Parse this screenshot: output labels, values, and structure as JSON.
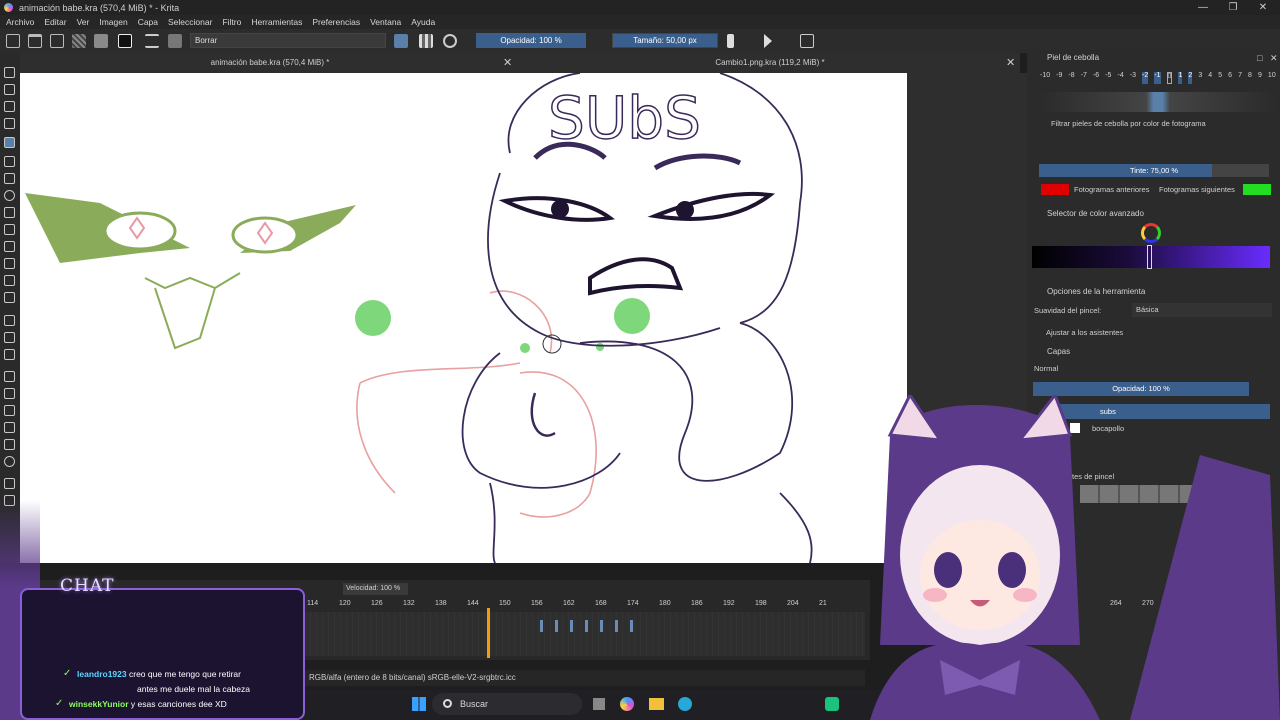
{
  "window": {
    "title": "animación babe.kra (570,4 MiB) * - Krita"
  },
  "menu": [
    "Archivo",
    "Editar",
    "Ver",
    "Imagen",
    "Capa",
    "Seleccionar",
    "Filtro",
    "Herramientas",
    "Preferencias",
    "Ventana",
    "Ayuda"
  ],
  "toolbar": {
    "brush_preset": "Borrar",
    "opacity": "Opacidad: 100 %",
    "size": "Tamaño: 50,00 px"
  },
  "tabs": [
    {
      "label": "animación babe.kra (570,4 MiB) *"
    },
    {
      "label": "Cambio1.png.kra (119,2 MiB) *"
    }
  ],
  "canvas": {
    "text": "SUbS"
  },
  "onion_skin": {
    "title": "Piel de cebolla",
    "frames": [
      "-10",
      "-9",
      "-8",
      "-7",
      "-6",
      "-5",
      "-4",
      "-3",
      "-2",
      "-1",
      "0",
      "1",
      "2",
      "3",
      "4",
      "5",
      "6",
      "7",
      "8",
      "9",
      "10"
    ],
    "filter_label": "Filtrar pieles de cebolla por color de fotograma",
    "tint": "Tinte: 75,00 %",
    "tint_level": 0.75,
    "prev_label": "Fotogramas anteriores",
    "next_label": "Fotogramas siguientes",
    "prev_color": "#e00000",
    "next_color": "#22dd22"
  },
  "color_selector": {
    "title": "Selector de color avanzado"
  },
  "tool_options": {
    "title": "Opciones de la herramienta",
    "smoothing_label": "Suavidad del pincel:",
    "smoothing_value": "Básica",
    "assistants_label": "Ajustar a los asistentes"
  },
  "layers": {
    "title": "Capas",
    "blend_mode": "Normal",
    "opacity": "Opacidad:  100 %",
    "items": [
      {
        "name": "subs"
      },
      {
        "name": "bocapollo"
      }
    ]
  },
  "brush_presets": {
    "title": "tes de pincel"
  },
  "timeline": {
    "speed": "Velocidad: 100 %",
    "ruler": [
      "114",
      "120",
      "126",
      "132",
      "138",
      "144",
      "150",
      "156",
      "162",
      "168",
      "174",
      "180",
      "186",
      "192",
      "198",
      "204",
      "21",
      "264",
      "270"
    ],
    "playhead_frame": 144
  },
  "status": {
    "text": "RGB/alfa (entero de 8 bits/canal)  sRGB-elle-V2-srgbtrc.icc"
  },
  "taskbar": {
    "search": "Buscar"
  },
  "chat": {
    "title": "CHAT",
    "messages": [
      {
        "user": "leandro1923",
        "text": "creo que me tengo que retirar",
        "cont": "antes me duele mal la cabeza"
      },
      {
        "user": "winsekkYunior",
        "text": "y esas canciones dee XD"
      }
    ]
  },
  "colors": {
    "accent": "#3a5f8c",
    "chat_border": "#8b5fd6"
  }
}
